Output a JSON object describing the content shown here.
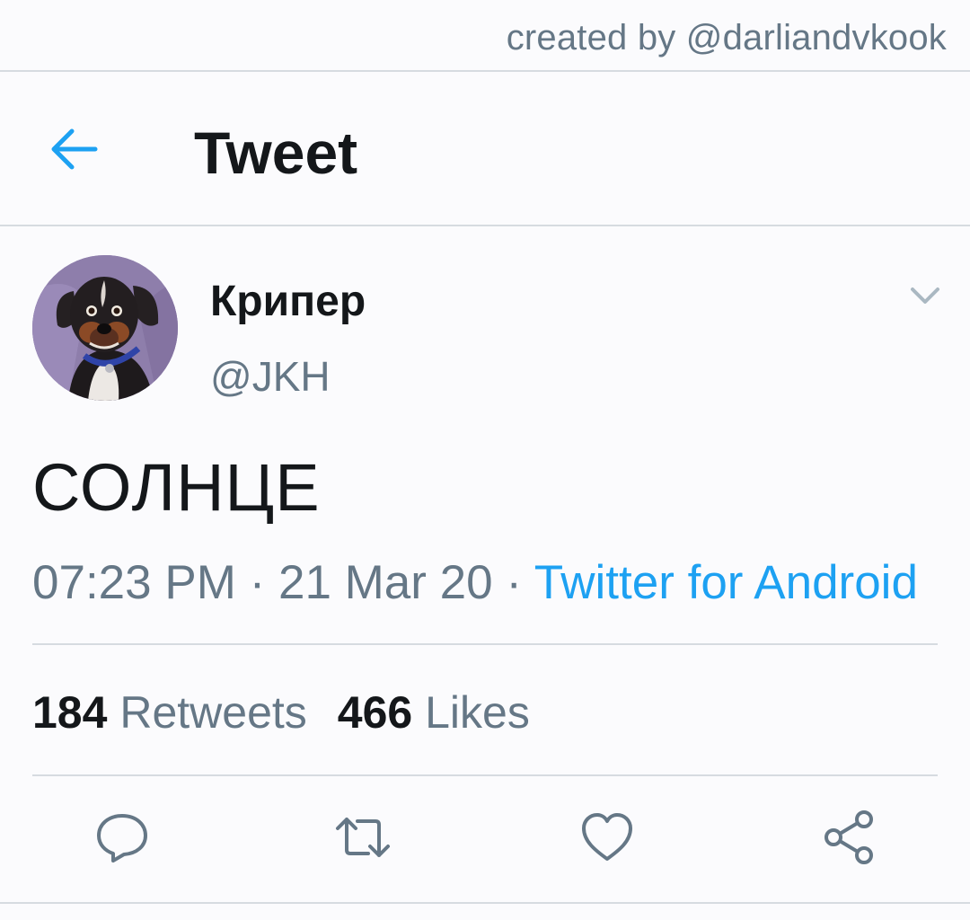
{
  "credit": "created by @darliandvkook",
  "header": {
    "title": "Tweet",
    "back_icon": "arrow-left-icon"
  },
  "author": {
    "display_name": "Крипер",
    "handle": "@JKH",
    "avatar": "dog-avatar"
  },
  "tweet": {
    "text": "СОЛНЦЕ",
    "time": "07:23 PM",
    "separator": "·",
    "date": "21 Mar 20",
    "source": "Twitter for Android"
  },
  "stats": {
    "retweets_count": "184",
    "retweets_label": "Retweets",
    "likes_count": "466",
    "likes_label": "Likes"
  },
  "actions": [
    "reply-icon",
    "retweet-icon",
    "like-icon",
    "share-icon"
  ],
  "colors": {
    "accent": "#1da1f2",
    "text_primary": "#14171a",
    "text_secondary": "#657786",
    "divider": "#d6dbe0",
    "background": "#fbfbfd"
  }
}
